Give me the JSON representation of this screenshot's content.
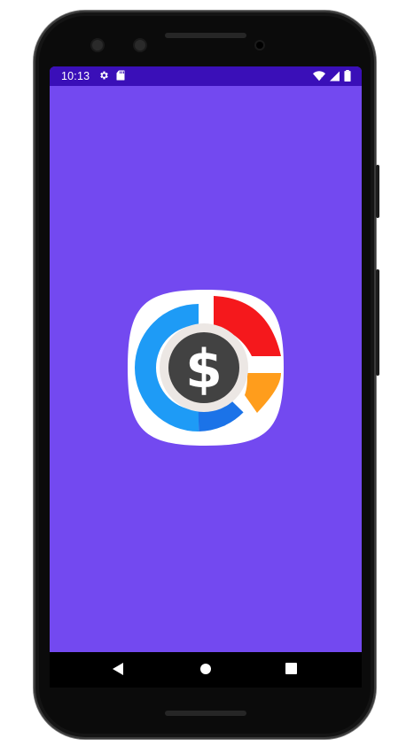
{
  "status_bar": {
    "time": "10:13",
    "left_icons": [
      "gear-icon",
      "sd-card-icon"
    ],
    "right_icons": [
      "wifi-icon",
      "cell-signal-icon",
      "battery-icon"
    ],
    "color": "#3a0fb8"
  },
  "splash": {
    "background_color": "#7349f0",
    "logo": {
      "icon": "dollar-chart-logo",
      "symbol": "$",
      "segment_colors": {
        "blue": "#1e9bf6",
        "dark_blue": "#1b73e8",
        "red": "#f5181c",
        "orange": "#ff9d1c",
        "center": "#424242"
      }
    }
  },
  "nav_bar": {
    "buttons": [
      "back-icon",
      "home-icon",
      "recents-icon"
    ]
  }
}
